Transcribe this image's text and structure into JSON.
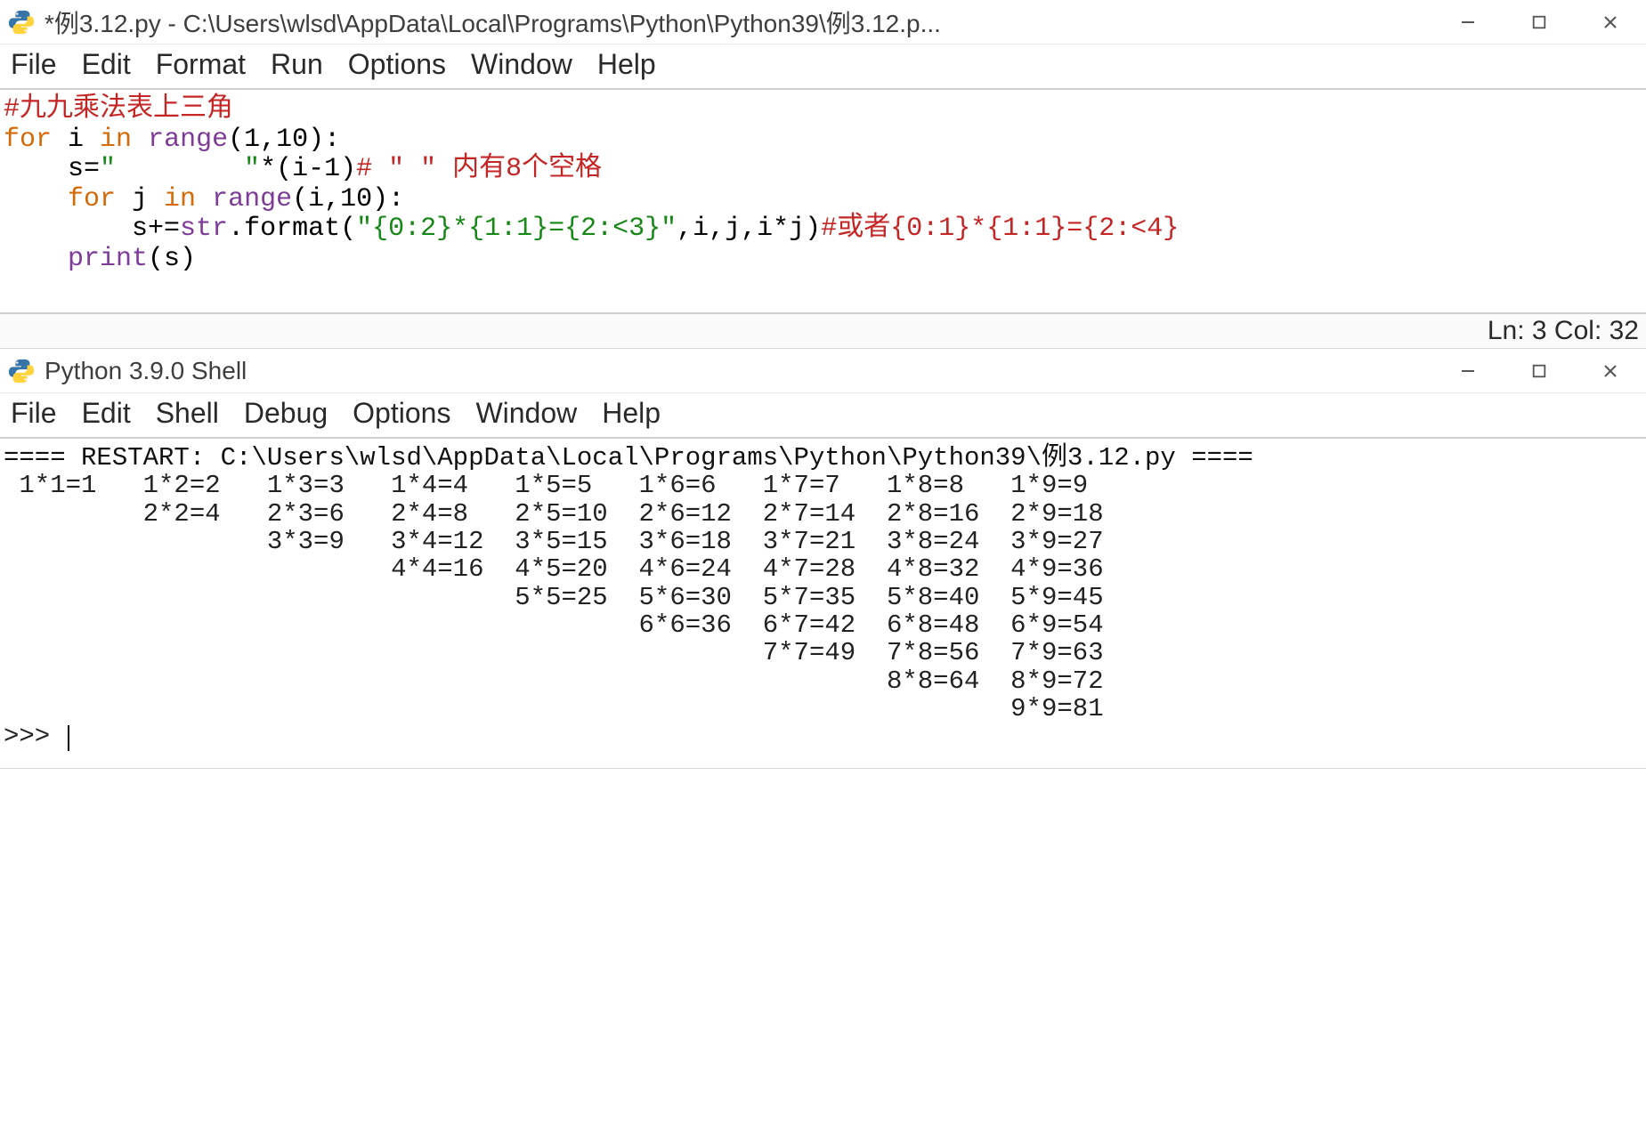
{
  "editor": {
    "title": "*例3.12.py - C:\\Users\\wlsd\\AppData\\Local\\Programs\\Python\\Python39\\例3.12.p...",
    "menu": [
      "File",
      "Edit",
      "Format",
      "Run",
      "Options",
      "Window",
      "Help"
    ],
    "status": "Ln: 3  Col: 32",
    "code": {
      "l1": {
        "comment": "#九九乘法表上三角"
      },
      "l2": {
        "kw1": "for",
        "t1": " i ",
        "kw2": "in",
        "t2": " ",
        "fn": "range",
        "t3": "(1,10):"
      },
      "l3": {
        "indent": "    ",
        "t1": "s=",
        "str1": "\"        \"",
        "t2": "*(i-1)",
        "comment": "# \" \" 内有8个空格"
      },
      "l4": {
        "indent": "    ",
        "kw1": "for",
        "t1": " j ",
        "kw2": "in",
        "t2": " ",
        "fn": "range",
        "t3": "(i,10):"
      },
      "l5": {
        "indent": "        ",
        "t1": "s+=",
        "fn": "str",
        "t2": ".format(",
        "str1": "\"{0:2}*{1:1}={2:<3}\"",
        "t3": ",i,j,i*j)",
        "comment": "#或者{0:1}*{1:1}={2:<4}"
      },
      "l6": {
        "indent": "    ",
        "fn": "print",
        "t1": "(s)"
      }
    }
  },
  "shell": {
    "title": "Python 3.9.0 Shell",
    "menu": [
      "File",
      "Edit",
      "Shell",
      "Debug",
      "Options",
      "Window",
      "Help"
    ],
    "restart_line": "==== RESTART: C:\\Users\\wlsd\\AppData\\Local\\Programs\\Python\\Python39\\例3.12.py ====",
    "output_rows": [
      " 1*1=1   1*2=2   1*3=3   1*4=4   1*5=5   1*6=6   1*7=7   1*8=8   1*9=9",
      "         2*2=4   2*3=6   2*4=8   2*5=10  2*6=12  2*7=14  2*8=16  2*9=18",
      "                 3*3=9   3*4=12  3*5=15  3*6=18  3*7=21  3*8=24  3*9=27",
      "                         4*4=16  4*5=20  4*6=24  4*7=28  4*8=32  4*9=36",
      "                                 5*5=25  5*6=30  5*7=35  5*8=40  5*9=45",
      "                                         6*6=36  6*7=42  6*8=48  6*9=54",
      "                                                 7*7=49  7*8=56  7*9=63",
      "                                                         8*8=64  8*9=72",
      "                                                                 9*9=81"
    ],
    "prompt": ">>> "
  }
}
